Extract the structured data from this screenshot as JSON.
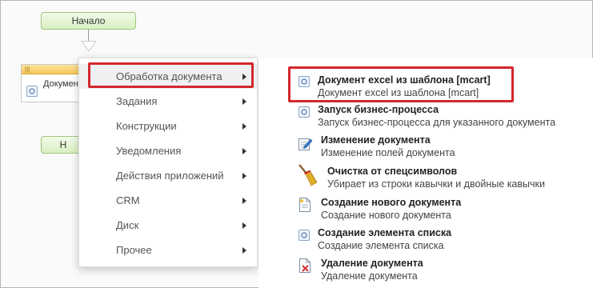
{
  "canvas": {
    "start_label": "Начало",
    "activity_label": "Документ excel из шаблона",
    "end_label": "Н"
  },
  "menu": {
    "items": [
      {
        "label": "Обработка документа"
      },
      {
        "label": "Задания"
      },
      {
        "label": "Конструкции"
      },
      {
        "label": "Уведомления"
      },
      {
        "label": "Действия приложений"
      },
      {
        "label": "CRM"
      },
      {
        "label": "Диск"
      },
      {
        "label": "Прочее"
      }
    ]
  },
  "submenu": {
    "items": [
      {
        "title": "Документ excel из шаблона [mcart]",
        "desc": "Документ excel из шаблона [mcart]",
        "icon": "document-gear-icon"
      },
      {
        "title": "Запуск бизнес-процесса",
        "desc": "Запуск бизнес-процесса для указанного документа",
        "icon": "document-gear-icon"
      },
      {
        "title": "Изменение документа",
        "desc": "Изменение полей документа",
        "icon": "edit-document-icon"
      },
      {
        "title": "Очистка от спецсимволов",
        "desc": "Убирает из строки кавычки и двойные кавычки",
        "icon": "broom-icon"
      },
      {
        "title": "Создание нового документа",
        "desc": "Создание нового документа",
        "icon": "new-document-icon"
      },
      {
        "title": "Создание элемента списка",
        "desc": "Создание элемента списка",
        "icon": "document-gear-icon"
      },
      {
        "title": "Удаление документа",
        "desc": "Удаление документа",
        "icon": "delete-document-icon"
      }
    ]
  },
  "colors": {
    "highlight": "#d3272c",
    "node_green": "#d9efc2",
    "node_header_yellow": "#f7c85a"
  }
}
